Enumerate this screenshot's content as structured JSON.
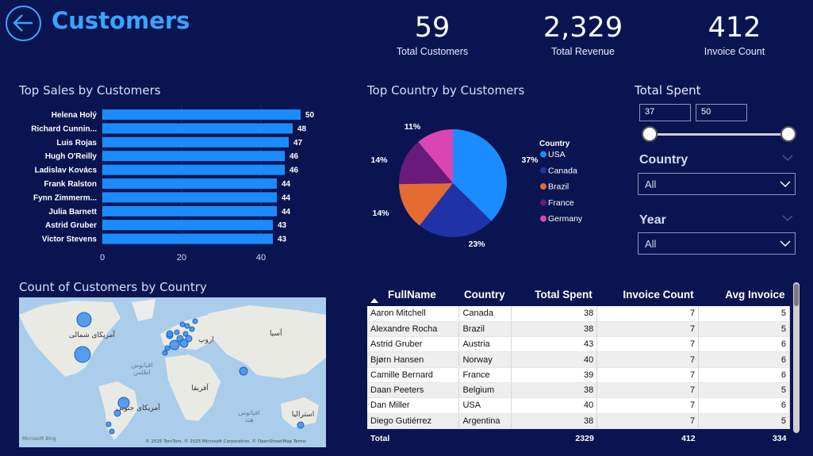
{
  "header": {
    "title": "Customers"
  },
  "kpis": [
    {
      "value": "59",
      "label": "Total Customers"
    },
    {
      "value": "2,329",
      "label": "Total Revenue"
    },
    {
      "value": "412",
      "label": "Invoice Count"
    }
  ],
  "bar_section": {
    "title": "Top Sales by Customers"
  },
  "pie_section": {
    "title": "Top Country by Customers",
    "legend_title": "Country"
  },
  "map_section": {
    "title": "Count of Customers by Country",
    "labels": {
      "north_america": "آمریکای شمالی",
      "south_america": "آمریکای جنوبی",
      "europe": "اروپ",
      "asia": "آسیا",
      "africa": "آفریقا",
      "australia": "استرالیا",
      "atlantic": "اقیانوس\nاطلس",
      "indian": "اقیانوس\nهند"
    },
    "attribution": "© 2025 TomTom, © 2025 Microsoft Corporation, © OpenStreetMap Terms",
    "brand": "Microsoft Bing"
  },
  "slicers": {
    "total_spent": {
      "title": "Total Spent",
      "min": "37",
      "max": "50"
    },
    "country": {
      "title": "Country",
      "value": "All"
    },
    "year": {
      "title": "Year",
      "value": "All"
    }
  },
  "table": {
    "headers": [
      "FullName",
      "Country",
      "Total Spent",
      "Invoice Count",
      "Avg Invoice"
    ],
    "rows": [
      [
        "Aaron Mitchell",
        "Canada",
        "38",
        "7",
        "5"
      ],
      [
        "Alexandre Rocha",
        "Brazil",
        "38",
        "7",
        "5"
      ],
      [
        "Astrid Gruber",
        "Austria",
        "43",
        "7",
        "6"
      ],
      [
        "Bjørn Hansen",
        "Norway",
        "40",
        "7",
        "6"
      ],
      [
        "Camille Bernard",
        "France",
        "39",
        "7",
        "6"
      ],
      [
        "Daan Peeters",
        "Belgium",
        "38",
        "7",
        "5"
      ],
      [
        "Dan Miller",
        "USA",
        "40",
        "7",
        "6"
      ],
      [
        "Diego Gutiérrez",
        "Argentina",
        "38",
        "7",
        "5"
      ]
    ],
    "totals": {
      "label": "Total",
      "total_spent": "2329",
      "invoice_count": "412",
      "avg_invoice": "334"
    }
  },
  "chart_data": [
    {
      "type": "bar",
      "orientation": "horizontal",
      "title": "Top Sales by Customers",
      "categories": [
        "Helena Holý",
        "Richard Cunnin...",
        "Luis Rojas",
        "Hugh O'Reilly",
        "Ladislav Kovács",
        "Frank Ralston",
        "Fynn Zimmerm...",
        "Julia Barnett",
        "Astrid Gruber",
        "Victor Stevens"
      ],
      "values": [
        50,
        48,
        47,
        46,
        46,
        44,
        44,
        44,
        43,
        43
      ],
      "xticks": [
        0,
        20,
        40
      ],
      "xlim": [
        0,
        50
      ],
      "color": "#1a8cff",
      "grid": true
    },
    {
      "type": "pie",
      "title": "Top Country by Customers",
      "legend_title": "Country",
      "legend_position": "right",
      "labels": [
        "USA",
        "Canada",
        "Brazil",
        "France",
        "Germany"
      ],
      "values": [
        37,
        23,
        14,
        14,
        11
      ],
      "display_labels": [
        "37%",
        "23%",
        "14%",
        "14%",
        "11%"
      ],
      "colors": [
        "#1a8cff",
        "#1f32a8",
        "#e46c32",
        "#6a1b7a",
        "#d946b3"
      ]
    }
  ]
}
